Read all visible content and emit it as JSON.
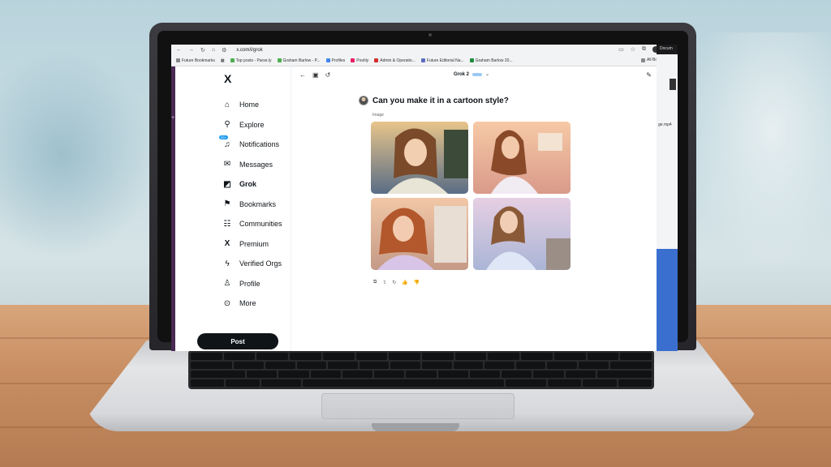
{
  "browser": {
    "url": "x.com/i/grok",
    "bookmarks": [
      {
        "label": "Future Bookmarks",
        "color": "#888888"
      },
      {
        "label": "Top posts - Parse.ly",
        "color": "#4caf50"
      },
      {
        "label": "Graham Barlow - P...",
        "color": "#4caf50"
      },
      {
        "label": "Profiles",
        "color": "#4285f4"
      },
      {
        "label": "Poshly",
        "color": "#e91e63"
      },
      {
        "label": "Admin & Operatio...",
        "color": "#d32f2f"
      },
      {
        "label": "Future Editorial Na...",
        "color": "#5c6bc0"
      },
      {
        "label": "Graham Barlow 20...",
        "color": "#1e8e3e"
      }
    ],
    "all_bookmarks": "All Bookmarks"
  },
  "side_window": {
    "title": "Docum",
    "file": "ge.mp4"
  },
  "sidebar": {
    "logo": "X",
    "items": [
      {
        "label": "Home",
        "icon": "home-icon",
        "glyph": "⌂"
      },
      {
        "label": "Explore",
        "icon": "search-icon",
        "glyph": "⚲"
      },
      {
        "label": "Notifications",
        "icon": "bell-icon",
        "glyph": "🔔",
        "badge": "20+"
      },
      {
        "label": "Messages",
        "icon": "mail-icon",
        "glyph": "✉"
      },
      {
        "label": "Grok",
        "icon": "grok-icon",
        "glyph": "◩",
        "active": true
      },
      {
        "label": "Bookmarks",
        "icon": "bookmark-icon",
        "glyph": "⚑"
      },
      {
        "label": "Communities",
        "icon": "communities-icon",
        "glyph": "👥"
      },
      {
        "label": "Premium",
        "icon": "x-premium-icon",
        "glyph": "𝕏"
      },
      {
        "label": "Verified Orgs",
        "icon": "lightning-icon",
        "glyph": "ϟ"
      },
      {
        "label": "Profile",
        "icon": "profile-icon",
        "glyph": "👤"
      },
      {
        "label": "More",
        "icon": "more-icon",
        "glyph": "⊙"
      }
    ],
    "post_label": "Post"
  },
  "grok": {
    "title": "Grok 2",
    "question": "Can you make it in a cartoon style?",
    "image_label": "Image"
  }
}
